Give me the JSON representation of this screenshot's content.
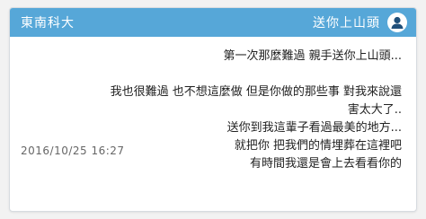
{
  "header": {
    "school": "東南科大",
    "title": "送你上山頭",
    "avatar_icon": "user-avatar-icon"
  },
  "post": {
    "lines": [
      "第一次那麼難過   親手送你上山頭...",
      "",
      "我也很難過 也不想這麼做 但是你做的那些事  對我來說還",
      "害太大了..",
      "送你到我這輩子看過最美的地方...",
      "就把你  把我們的情埋葬在這裡吧",
      "有時間我還是會上去看看你的"
    ],
    "timestamp": "2016/10/25 16:27"
  },
  "colors": {
    "header_bg": "#56a7d8",
    "page_bg": "#f2f2f2"
  }
}
